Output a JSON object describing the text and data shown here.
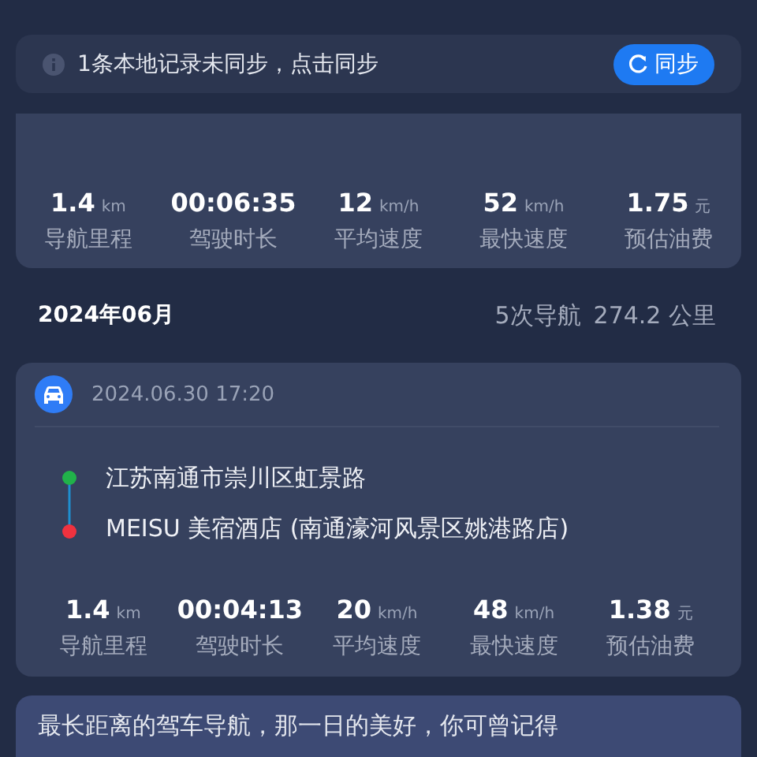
{
  "sync_banner": {
    "message": "1条本地记录未同步，点击同步",
    "button": "同步"
  },
  "summary_stats": [
    {
      "value": "1.4",
      "unit": "km",
      "label": "导航里程"
    },
    {
      "value": "00:06:35",
      "label": "驾驶时长"
    },
    {
      "value": "12",
      "unit": "km/h",
      "label": "平均速度"
    },
    {
      "value": "52",
      "unit": "km/h",
      "label": "最快速度"
    },
    {
      "value": "1.75",
      "unit": "元",
      "label": "预估油费"
    }
  ],
  "month": {
    "title": "2024年06月",
    "count": "5次导航",
    "distance": "274.2 公里"
  },
  "trips": [
    {
      "time": "2024.06.30 17:20",
      "start": "江苏南通市崇川区虹景路",
      "end": "MEISU 美宿酒店 (南通濠河风景区姚港路店)",
      "stats": [
        {
          "value": "1.4",
          "unit": "km",
          "label": "导航里程"
        },
        {
          "value": "00:04:13",
          "label": "驾驶时长"
        },
        {
          "value": "20",
          "unit": "km/h",
          "label": "平均速度"
        },
        {
          "value": "48",
          "unit": "km/h",
          "label": "最快速度"
        },
        {
          "value": "1.38",
          "unit": "元",
          "label": "预估油费"
        }
      ]
    }
  ],
  "footer_card": {
    "text": "最长距离的驾车导航，那一日的美好，你可曾记得"
  }
}
